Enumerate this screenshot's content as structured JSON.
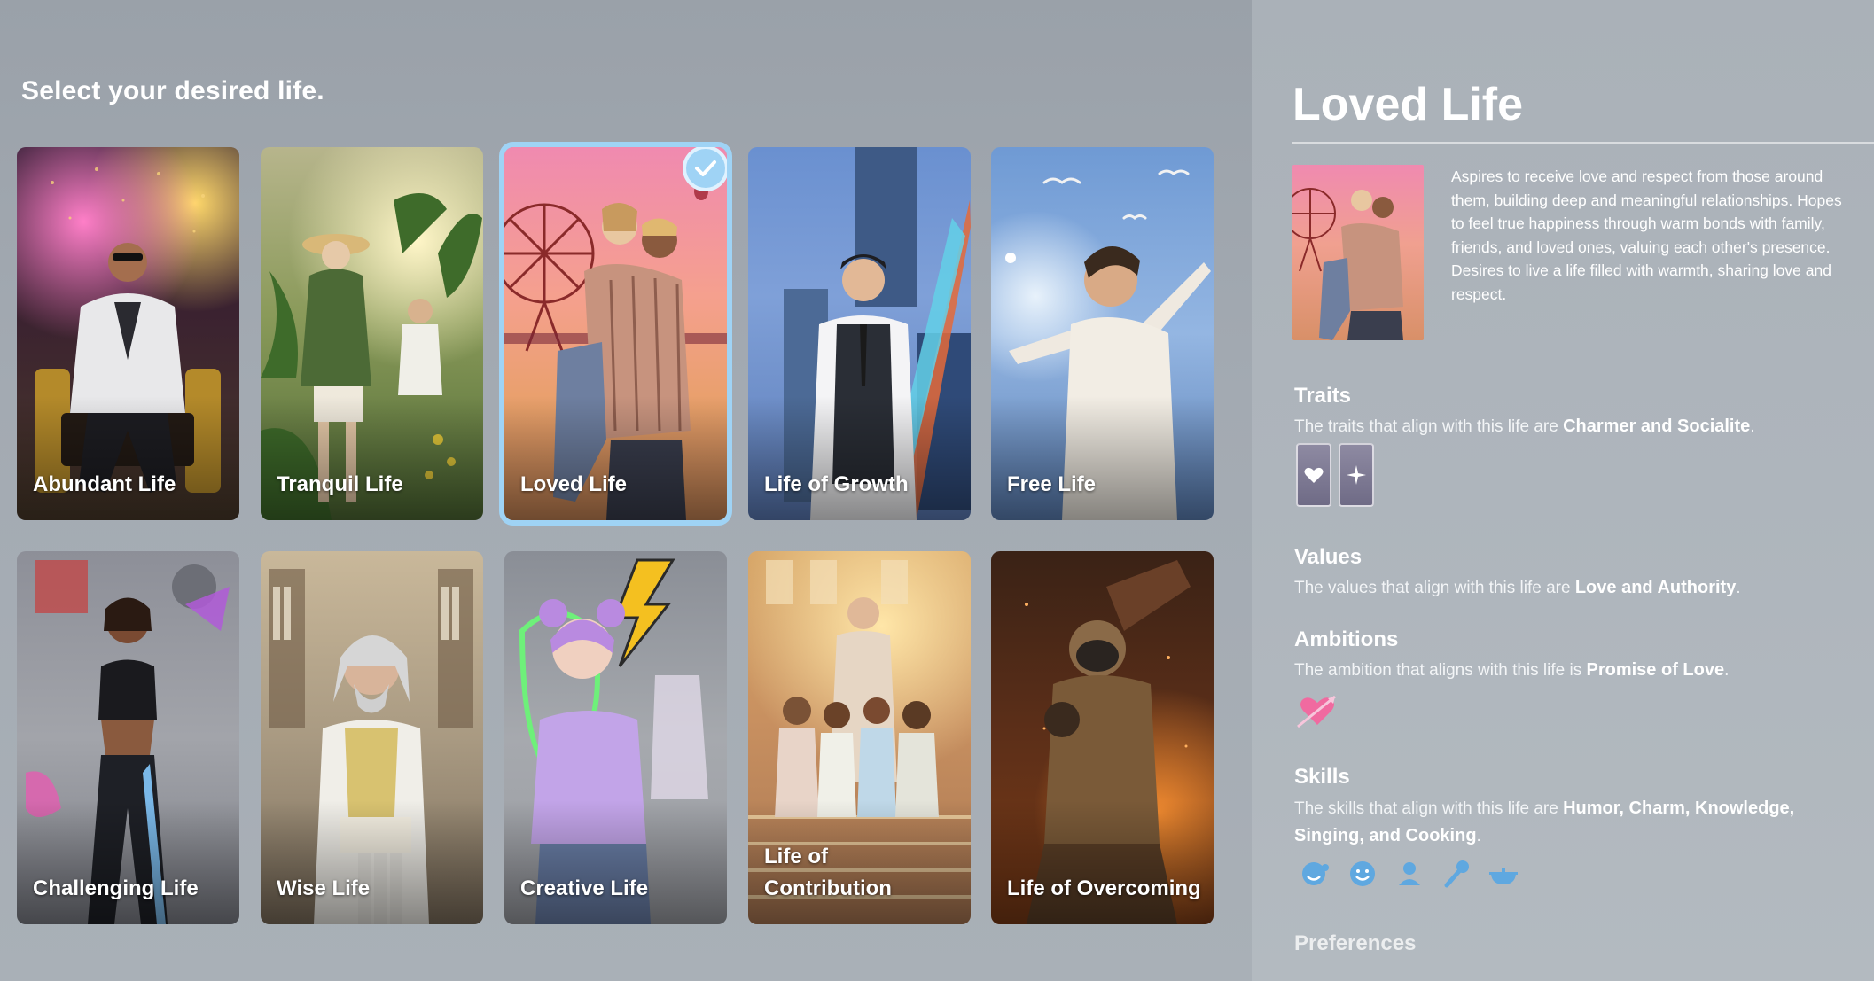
{
  "page": {
    "title": "Select your desired life."
  },
  "cards": [
    {
      "id": "abundant",
      "label": "Abundant Life",
      "selected": false
    },
    {
      "id": "tranquil",
      "label": "Tranquil Life",
      "selected": false
    },
    {
      "id": "loved",
      "label": "Loved Life",
      "selected": true
    },
    {
      "id": "growth",
      "label": "Life of Growth",
      "selected": false
    },
    {
      "id": "free",
      "label": "Free Life",
      "selected": false
    },
    {
      "id": "challenging",
      "label": "Challenging Life",
      "selected": false
    },
    {
      "id": "wise",
      "label": "Wise Life",
      "selected": false
    },
    {
      "id": "creative",
      "label": "Creative Life",
      "selected": false
    },
    {
      "id": "contribution",
      "label": "Life of Contribution",
      "selected": false
    },
    {
      "id": "overcoming",
      "label": "Life of Overcoming",
      "selected": false
    }
  ],
  "detail": {
    "title": "Loved Life",
    "description": "Aspires to receive love and respect from those around them, building deep and meaningful relationships. Hopes to feel true happiness through warm bonds with family, friends, and loved ones, valuing each other's presence. Desires to live a life filled with warmth, sharing love and respect.",
    "traits": {
      "heading": "Traits",
      "prefix": "The traits that align with this life are ",
      "highlight": "Charmer and Socialite",
      "suffix": ".",
      "icons": [
        "heart-trait-icon",
        "sparkle-trait-icon"
      ]
    },
    "values": {
      "heading": "Values",
      "prefix": "The values that align with this life are ",
      "highlight": "Love and Authority",
      "suffix": "."
    },
    "ambitions": {
      "heading": "Ambitions",
      "prefix": "The ambition that aligns with this life is ",
      "highlight": "Promise of Love",
      "suffix": ".",
      "icon": "heart-arrow-icon"
    },
    "skills": {
      "heading": "Skills",
      "prefix": "The skills that align with this life are ",
      "highlight": "Humor, Charm, Knowledge,",
      "highlight2": "Singing, and Cooking",
      "suffix": ".",
      "icons": [
        "humor-icon",
        "charm-icon",
        "knowledge-icon",
        "singing-icon",
        "cooking-icon"
      ]
    },
    "preferences": {
      "heading": "Preferences"
    }
  },
  "colors": {
    "selection": "#9fd3f5",
    "accent_skill": "#5fa8e0",
    "ambition_heart": "#f06aa0"
  }
}
